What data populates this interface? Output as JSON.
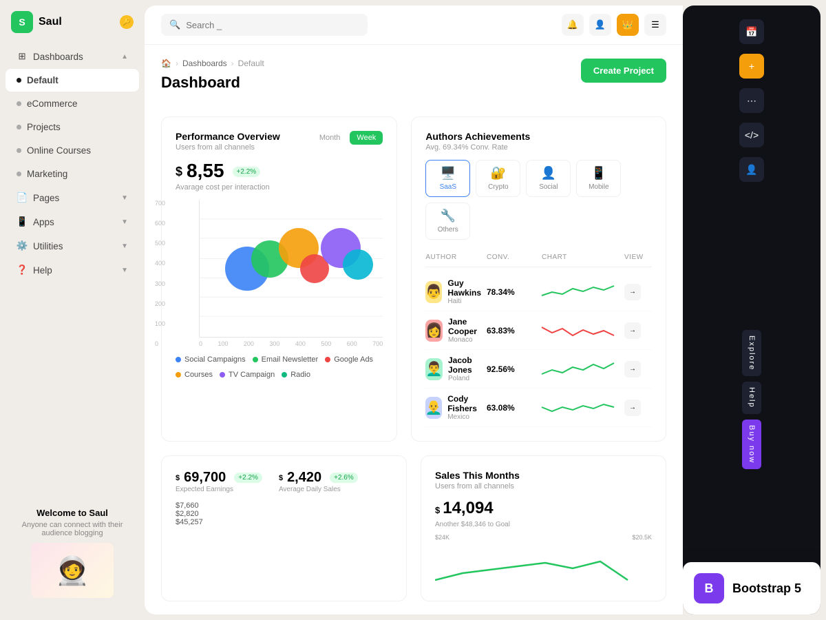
{
  "app": {
    "name": "Saul",
    "logo_letter": "S"
  },
  "topbar": {
    "search_placeholder": "Search _",
    "create_btn": "Create Project"
  },
  "sidebar": {
    "items": [
      {
        "label": "Dashboards",
        "has_arrow": true,
        "icon": "grid",
        "type": "section"
      },
      {
        "label": "Default",
        "active": true,
        "type": "child"
      },
      {
        "label": "eCommerce",
        "type": "child"
      },
      {
        "label": "Projects",
        "type": "child"
      },
      {
        "label": "Online Courses",
        "type": "child"
      },
      {
        "label": "Marketing",
        "type": "child"
      },
      {
        "label": "Pages",
        "has_arrow": true,
        "icon": "file",
        "type": "section"
      },
      {
        "label": "Apps",
        "has_arrow": true,
        "icon": "apps",
        "type": "section"
      },
      {
        "label": "Utilities",
        "has_arrow": true,
        "icon": "utils",
        "type": "section"
      },
      {
        "label": "Help",
        "has_arrow": true,
        "icon": "help",
        "type": "section"
      }
    ]
  },
  "sidebar_footer": {
    "title": "Welcome to Saul",
    "subtitle": "Anyone can connect with their audience blogging"
  },
  "breadcrumb": {
    "home": "🏠",
    "dashboards": "Dashboards",
    "current": "Default"
  },
  "page_title": "Dashboard",
  "performance": {
    "title": "Performance Overview",
    "subtitle": "Users from all channels",
    "tab_month": "Month",
    "tab_week": "Week",
    "metric_value": "8,55",
    "metric_symbol": "$",
    "metric_badge": "+2.2%",
    "metric_label": "Avarage cost per interaction",
    "y_labels": [
      "700",
      "600",
      "500",
      "400",
      "300",
      "200",
      "100",
      "0"
    ],
    "x_labels": [
      "0",
      "100",
      "200",
      "300",
      "400",
      "500",
      "600",
      "700"
    ],
    "legend": [
      {
        "label": "Social Campaigns",
        "color": "#3b82f6"
      },
      {
        "label": "Email Newsletter",
        "color": "#22c55e"
      },
      {
        "label": "Google Ads",
        "color": "#ef4444"
      },
      {
        "label": "Courses",
        "color": "#f59e0b"
      },
      {
        "label": "TV Campaign",
        "color": "#8b5cf6"
      },
      {
        "label": "Radio",
        "color": "#10b981"
      }
    ],
    "bubbles": [
      {
        "x": 18,
        "y": 55,
        "size": 60,
        "color": "#3b82f6"
      },
      {
        "x": 32,
        "y": 48,
        "size": 50,
        "color": "#22c55e"
      },
      {
        "x": 46,
        "y": 38,
        "size": 55,
        "color": "#f59e0b"
      },
      {
        "x": 57,
        "y": 52,
        "size": 40,
        "color": "#ef4444"
      },
      {
        "x": 68,
        "y": 38,
        "size": 55,
        "color": "#8b5cf6"
      },
      {
        "x": 79,
        "y": 50,
        "size": 42,
        "color": "#06b6d4"
      }
    ]
  },
  "authors": {
    "title": "Authors Achievements",
    "subtitle": "Avg. 69.34% Conv. Rate",
    "tabs": [
      {
        "label": "SaaS",
        "icon": "🖥️",
        "active": true
      },
      {
        "label": "Crypto",
        "icon": "🔐"
      },
      {
        "label": "Social",
        "icon": "👤"
      },
      {
        "label": "Mobile",
        "icon": "📱"
      },
      {
        "label": "Others",
        "icon": "🔧"
      }
    ],
    "headers": {
      "author": "AUTHOR",
      "conv": "CONV.",
      "chart": "CHART",
      "view": "VIEW"
    },
    "rows": [
      {
        "name": "Guy Hawkins",
        "country": "Haiti",
        "conv": "78.34%",
        "chart_color": "#22c55e",
        "avatar": "👨"
      },
      {
        "name": "Jane Cooper",
        "country": "Monaco",
        "conv": "63.83%",
        "chart_color": "#ef4444",
        "avatar": "👩"
      },
      {
        "name": "Jacob Jones",
        "country": "Poland",
        "conv": "92.56%",
        "chart_color": "#22c55e",
        "avatar": "👨‍🦱"
      },
      {
        "name": "Cody Fishers",
        "country": "Mexico",
        "conv": "63.08%",
        "chart_color": "#22c55e",
        "avatar": "👨‍🦲"
      }
    ]
  },
  "earnings": {
    "expected_value": "69,700",
    "expected_badge": "+2.2%",
    "expected_label": "Expected Earnings",
    "daily_value": "2,420",
    "daily_badge": "+2.6%",
    "daily_label": "Average Daily Sales",
    "items": [
      "$7,660",
      "$2,820",
      "$45,257"
    ]
  },
  "sales": {
    "title": "Sales This Months",
    "subtitle": "Users from all channels",
    "value": "14,094",
    "goal_text": "Another $48,346 to Goal",
    "y1": "$24K",
    "y2": "$20.5K"
  },
  "bootstrap_badge": {
    "icon": "B",
    "text": "Bootstrap 5"
  }
}
